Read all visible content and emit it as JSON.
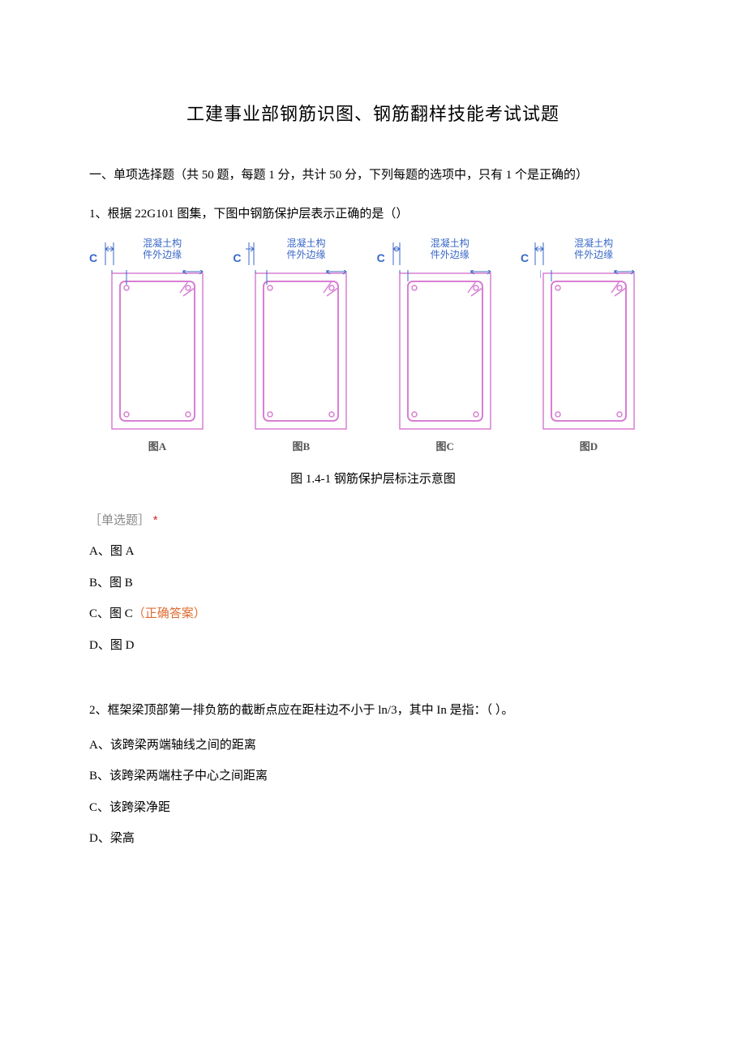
{
  "title": "工建事业部钢筋识图、钢筋翻样技能考试试题",
  "section1_intro": "一、单项选择题（共 50 题，每题 1 分，共计 50 分，下列每题的选项中，只有 1 个是正确的）",
  "q1": {
    "stem": "1、根据 22G101 图集，下图中钢筋保护层表示正确的是（）",
    "edge_label_line1": "混凝土构",
    "edge_label_line2": "件外边缘",
    "c_label": "C",
    "sub_a": "图A",
    "sub_b": "图B",
    "sub_c": "图C",
    "sub_d": "图D",
    "caption": "图 1.4-1 钢筋保护层标注示意图",
    "bracket_label": "［单选题］",
    "star": "*",
    "opt_a": "A、图 A",
    "opt_b": "B、图 B",
    "opt_c_prefix": "C、图 C",
    "opt_c_answer": "（正确答案）",
    "opt_d": "D、图 D"
  },
  "q2": {
    "stem": "2、框架梁顶部第一排负筋的截断点应在距柱边不小于 ln/3，其中 In 是指：（ ）。",
    "opt_a": "A、该跨梁两端轴线之间的距离",
    "opt_b": "B、该跨梁两端柱子中心之间距离",
    "opt_c": "C、该跨梁净距",
    "opt_d": "D、梁高"
  }
}
